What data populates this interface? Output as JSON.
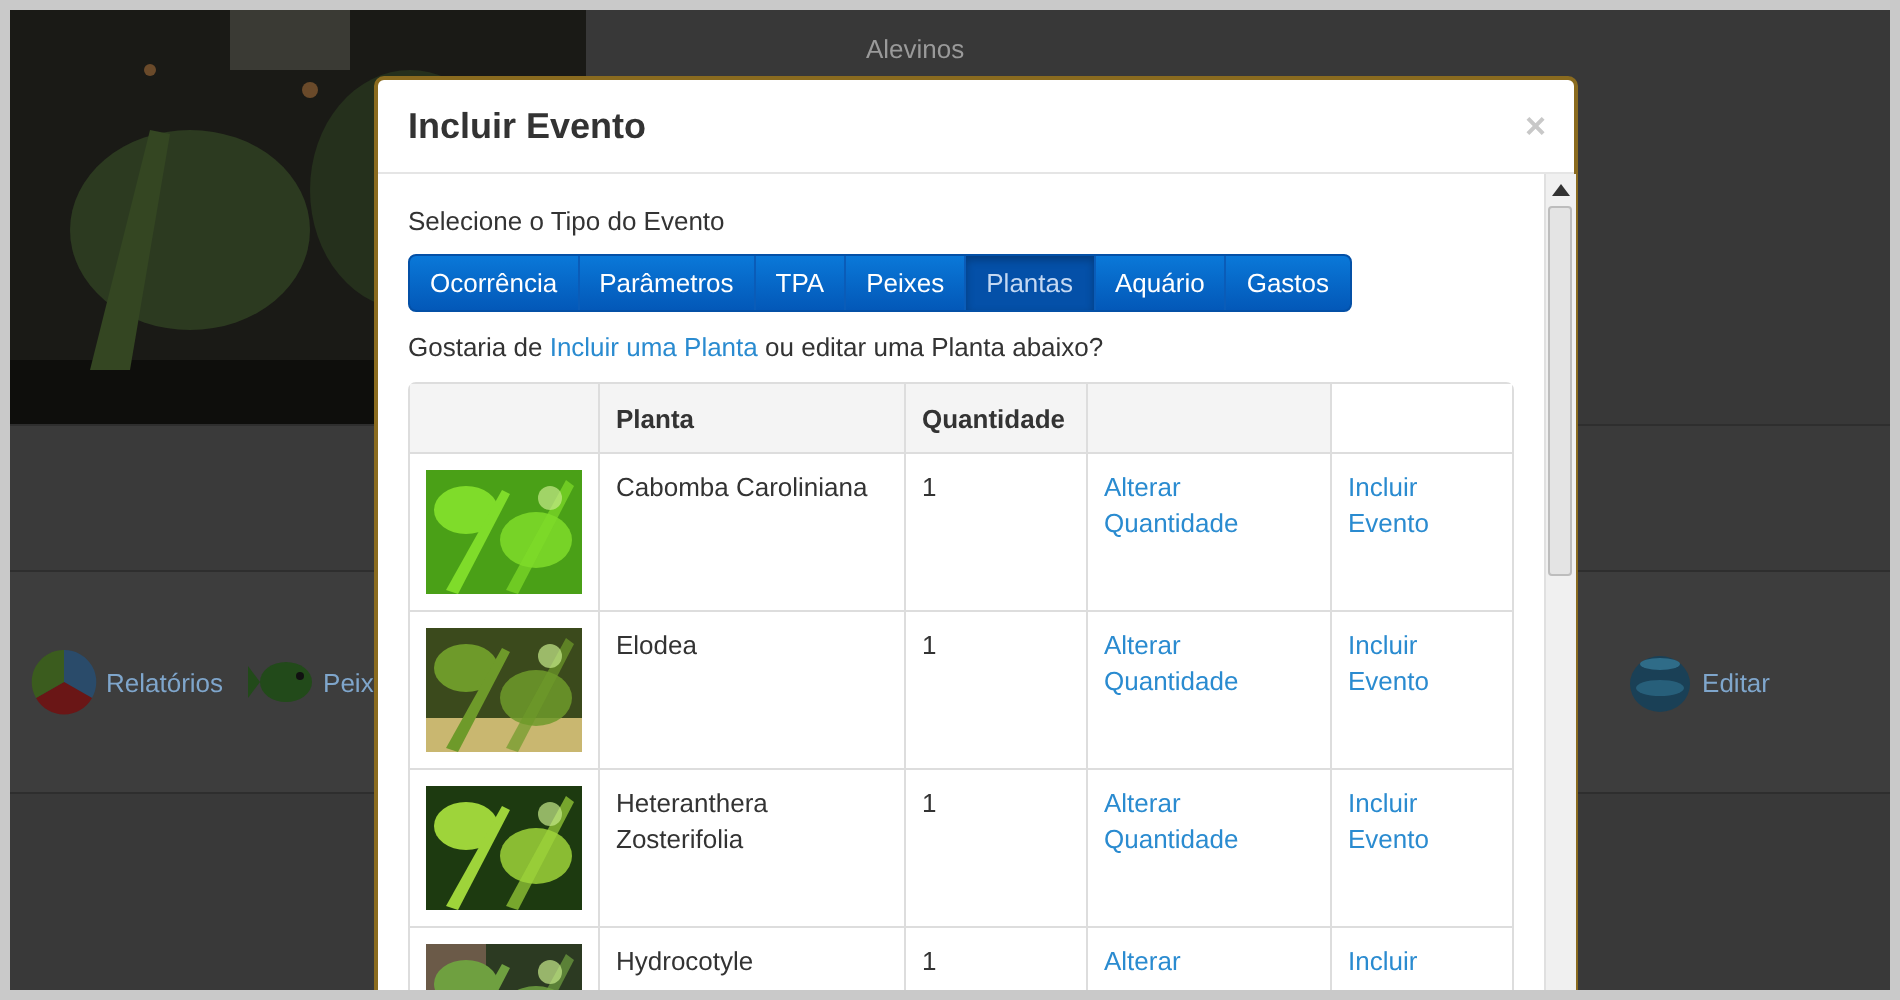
{
  "background_page": {
    "details": [
      {
        "value": "Alevinos"
      }
    ],
    "toolbar_left": [
      {
        "kind": "chart",
        "label": "Relatórios"
      },
      {
        "kind": "fish",
        "label": "Peix"
      }
    ],
    "toolbar_right": [
      {
        "kind": "bowl",
        "label": "Editar"
      }
    ]
  },
  "modal": {
    "title": "Incluir Evento",
    "close": "×",
    "prompt": "Selecione o Tipo do Evento",
    "tabs": [
      {
        "label": "Ocorrência",
        "selected": false
      },
      {
        "label": "Parâmetros",
        "selected": false
      },
      {
        "label": "TPA",
        "selected": false
      },
      {
        "label": "Peixes",
        "selected": false
      },
      {
        "label": "Plantas",
        "selected": true
      },
      {
        "label": "Aquário",
        "selected": false
      },
      {
        "label": "Gastos",
        "selected": false
      }
    ],
    "question": {
      "before": "Gostaria de",
      "link": "Incluir uma Planta",
      "after": "ou editar uma Planta abaixo?"
    },
    "table": {
      "columns": [
        "Planta",
        "Quantidade"
      ],
      "rows": [
        {
          "plant": "Cabomba Caroliniana",
          "quantity": "1",
          "action_1": "Alterar Quantidade",
          "action_2": "Incluir Evento"
        },
        {
          "plant": "Elodea",
          "quantity": "1",
          "action_1": "Alterar Quantidade",
          "action_2": "Incluir Evento"
        },
        {
          "plant": "Heteranthera Zosterifolia",
          "quantity": "1",
          "action_1": "Alterar Quantidade",
          "action_2": "Incluir Evento"
        },
        {
          "plant": "Hydrocotyle",
          "quantity": "1",
          "action_1": "Alterar",
          "action_2": "Incluir"
        }
      ]
    }
  }
}
